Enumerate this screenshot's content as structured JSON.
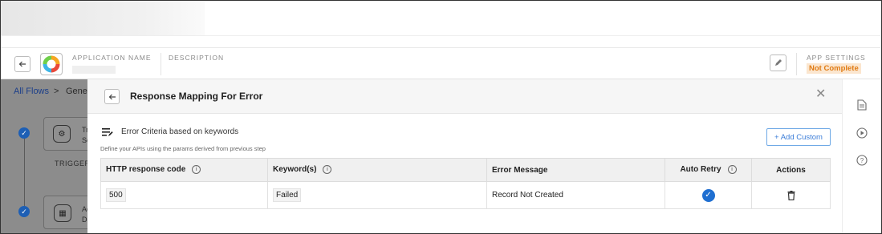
{
  "app_header": {
    "application_name_label": "APPLICATION NAME",
    "description_label": "DESCRIPTION",
    "app_settings_label": "APP SETTINGS",
    "status_badge": "Not Complete",
    "status_color": "#e07b14"
  },
  "breadcrumb": {
    "all_flows": "All Flows",
    "separator": ">",
    "current": "Gener"
  },
  "flow": {
    "trigger_card": {
      "title": "Tr",
      "subtitle": "Se"
    },
    "trigger_label": "TRIGGER",
    "action_card": {
      "title": "Ac",
      "subtitle": "De"
    }
  },
  "panel": {
    "title": "Response Mapping For Error",
    "criteria_title": "Error Criteria based on keywords",
    "criteria_subtitle": "Define your APIs using the params derived from previous step",
    "add_custom_label": "+ Add Custom",
    "table": {
      "headers": {
        "code": "HTTP response code",
        "keywords": "Keyword(s)",
        "message": "Error Message",
        "auto_retry": "Auto Retry",
        "actions": "Actions"
      },
      "rows": [
        {
          "code": "500",
          "keyword": "Failed",
          "message": "Record Not Created",
          "auto_retry": true
        }
      ]
    }
  },
  "icons": {
    "back": "arrow-left-icon",
    "close": "close-icon",
    "edit": "pencil-icon",
    "info": "info-icon",
    "check": "check-circle-icon",
    "delete": "trash-icon",
    "document": "document-icon",
    "play": "play-circle-icon",
    "help": "help-circle-icon"
  },
  "colors": {
    "accent": "#1f6fd1",
    "link": "#1c3f8a"
  }
}
